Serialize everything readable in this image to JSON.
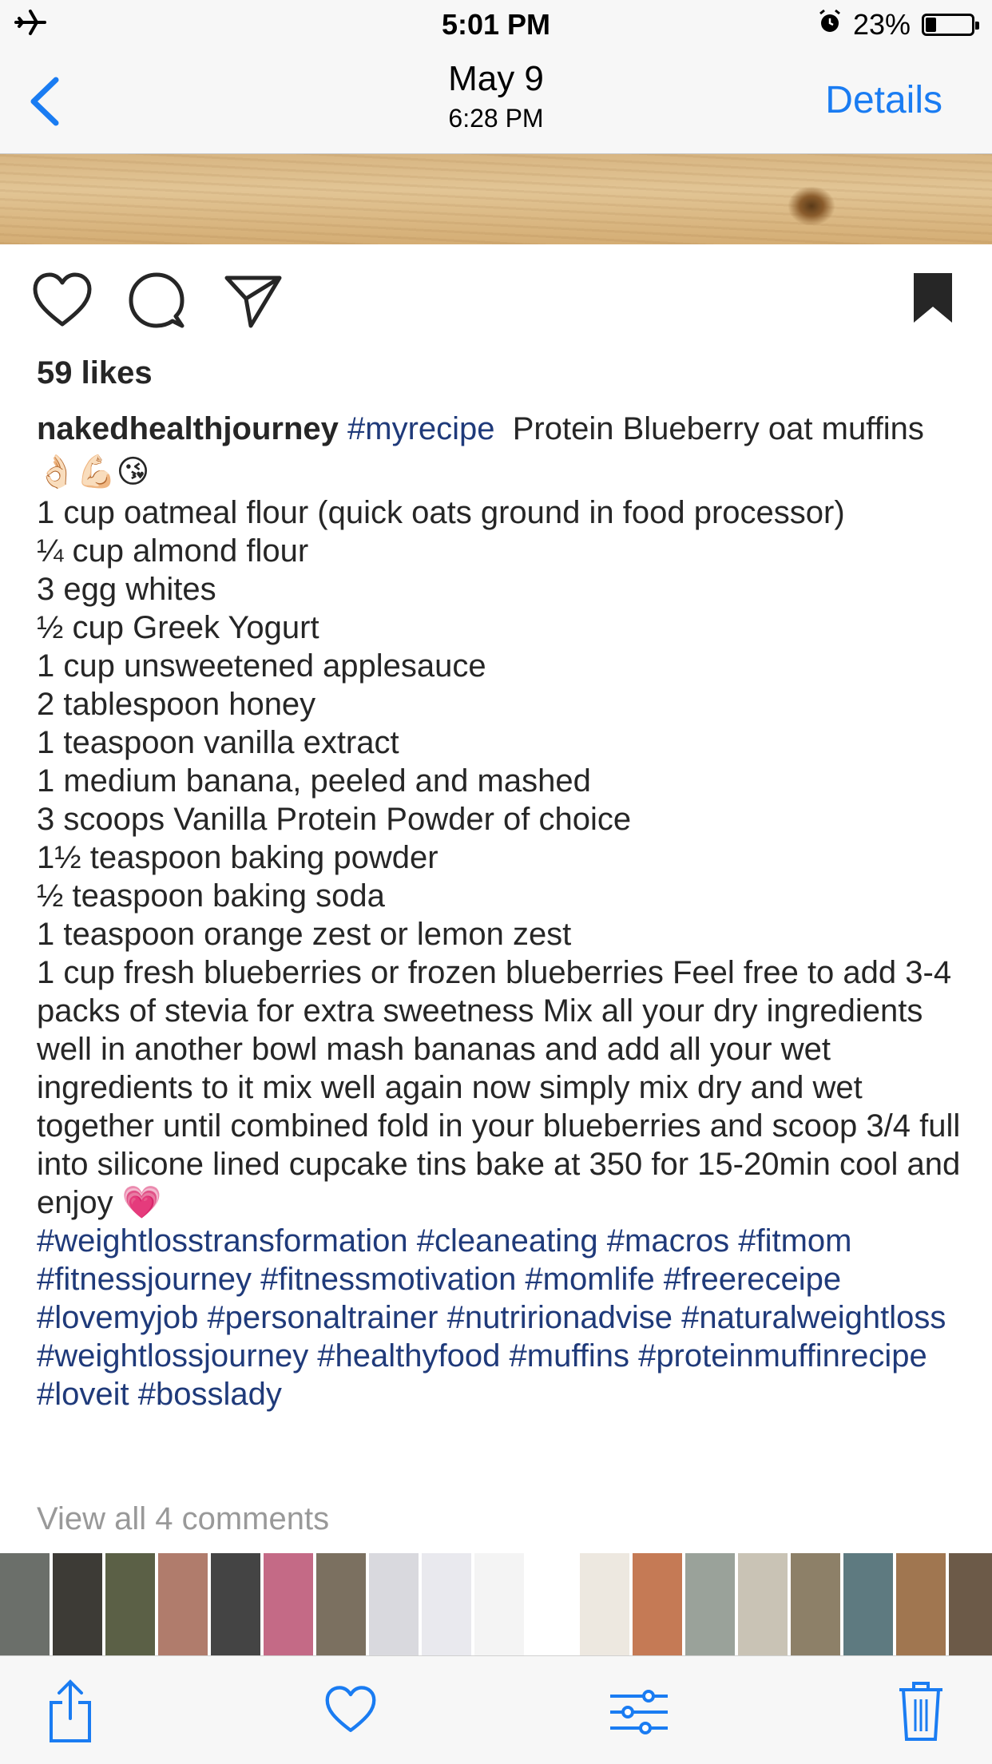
{
  "status_bar": {
    "airplane_icon": "airplane-icon",
    "time": "5:01 PM",
    "alarm_icon": "alarm-icon",
    "battery": "23%",
    "battery_level": 0.23
  },
  "nav": {
    "date": "May 9",
    "time": "6:28 PM",
    "details": "Details"
  },
  "post": {
    "likes": "59 likes",
    "username": "nakedhealthjourney",
    "first_tag": "#myrecipe",
    "title_text": "  Protein Blueberry oat muffins 👌🏻💪🏻😘",
    "ingredients": [
      "1 cup oatmeal flour (quick oats ground in food processor)",
      "¼ cup almond flour",
      "3 egg whites",
      "½ cup Greek Yogurt",
      "1 cup unsweetened applesauce",
      "2 tablespoon honey",
      "1 teaspoon vanilla extract",
      "1 medium banana, peeled and mashed",
      "3 scoops Vanilla Protein Powder of choice",
      "1½ teaspoon baking powder",
      "½ teaspoon baking soda",
      "1 teaspoon orange zest or lemon zest"
    ],
    "instructions": "1 cup fresh blueberries or frozen blueberries  Feel free to add 3-4 packs of stevia for extra sweetness  Mix all your dry ingredients well in another bowl mash bananas and add all your wet ingredients to it mix well again now simply mix dry and wet together until combined fold in your blueberries and scoop 3/4 full into silicone lined cupcake tins bake at 350 for 15-20min cool and enjoy 💗",
    "hashtags": "#weightlosstransformation #cleaneating #macros #fitmom #fitnessjourney #fitnessmotivation #momlife #freereceipe #lovemyjob #personaltrainer #nutririonadvise #naturalweightloss #weightlossjourney #healthyfood #muffins #proteinmuffinrecipe #loveit #bosslady",
    "view_comments": "View all 4 comments"
  },
  "thumbnails": [
    "#6b6f6a",
    "#3d3b36",
    "#5b6046",
    "#b07c6c",
    "#444444",
    "#c46a86",
    "#7b7060",
    "#d9d9de",
    "#e9e9ee",
    "#f4f4f4",
    "#ffffff",
    "#ede8e0",
    "#c57a55",
    "#9aa29a",
    "#c9c3b5",
    "#8d8068",
    "#5e7a80",
    "#a07650",
    "#6c5a48",
    "#7a6a58",
    "#9c8870",
    "#d8d0c4"
  ],
  "toolbar": {
    "share_icon": "share-icon",
    "favorite_icon": "heart-icon",
    "adjust_icon": "adjust-icon",
    "delete_icon": "trash-icon"
  },
  "colors": {
    "accent": "#1a7cf2",
    "hashtag": "#1f3a7a"
  }
}
